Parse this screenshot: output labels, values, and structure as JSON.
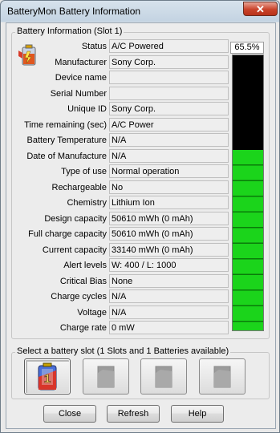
{
  "window": {
    "title": "BatteryMon Battery Information",
    "close_label": "✕"
  },
  "info_group": {
    "legend": "Battery Information (Slot 1)"
  },
  "fields": [
    {
      "label": "Status",
      "value": "A/C Powered"
    },
    {
      "label": "Manufacturer",
      "value": "Sony Corp."
    },
    {
      "label": "Device name",
      "value": ""
    },
    {
      "label": "Serial Number",
      "value": ""
    },
    {
      "label": "Unique ID",
      "value": "Sony Corp."
    },
    {
      "label": "Time remaining (sec)",
      "value": "A/C Power"
    },
    {
      "label": "Battery Temperature",
      "value": "N/A"
    },
    {
      "label": "Date of Manufacture",
      "value": "N/A"
    },
    {
      "label": "Type of use",
      "value": "Normal operation"
    },
    {
      "label": "Rechargeable",
      "value": "No"
    },
    {
      "label": "Chemistry",
      "value": "Lithium Ion"
    },
    {
      "label": "Design capacity",
      "value": "50610 mWh (0 mAh)"
    },
    {
      "label": "Full charge capacity",
      "value": "50610 mWh (0 mAh)"
    },
    {
      "label": "Current capacity",
      "value": "33140 mWh (0 mAh)"
    },
    {
      "label": "Alert levels",
      "value": "W: 400 / L: 1000"
    },
    {
      "label": "Critical Bias",
      "value": "None"
    },
    {
      "label": "Charge cycles",
      "value": "N/A"
    },
    {
      "label": "Voltage",
      "value": "N/A"
    },
    {
      "label": "Charge rate",
      "value": "0 mW"
    }
  ],
  "charge_gauge": {
    "percent_label": "65.5%",
    "level": 0.655
  },
  "slot_group": {
    "legend": "Select a battery slot (1 Slots and 1 Batteries available)",
    "slots": [
      {
        "icon": "battery-slot-1-icon",
        "active": true
      },
      {
        "icon": "empty-slot-icon",
        "active": false
      },
      {
        "icon": "empty-slot-icon",
        "active": false
      },
      {
        "icon": "empty-slot-icon",
        "active": false
      }
    ]
  },
  "buttons": {
    "close": "Close",
    "refresh": "Refresh",
    "help": "Help"
  },
  "colors": {
    "gauge_fill": "#1bd41b",
    "gauge_empty": "#000000",
    "close_button": "#c9432a"
  }
}
